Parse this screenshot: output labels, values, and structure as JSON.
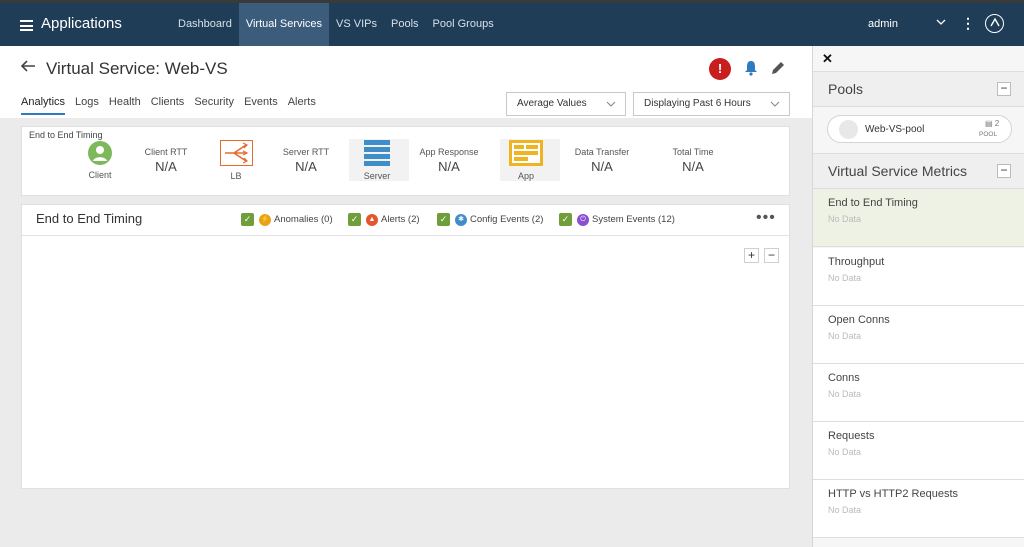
{
  "nav": {
    "title": "Applications",
    "tabs": [
      "Dashboard",
      "Virtual Services",
      "VS VIPs",
      "Pools",
      "Pool Groups"
    ],
    "user": "admin"
  },
  "header": {
    "title": "Virtual Service:  Web-VS",
    "alert_glyph": "!",
    "tabs": [
      "Analytics",
      "Logs",
      "Health",
      "Clients",
      "Security",
      "Events",
      "Alerts"
    ],
    "value_mode": "Average Values",
    "time_range": "Displaying Past 6 Hours"
  },
  "timing": {
    "label": "End to End Timing",
    "nodes": {
      "client": "Client",
      "lb": "LB",
      "server": "Server",
      "app": "App"
    },
    "metrics": [
      {
        "label": "Client RTT",
        "value": "N/A"
      },
      {
        "label": "Server RTT",
        "value": "N/A"
      },
      {
        "label": "App Response",
        "value": "N/A"
      },
      {
        "label": "Data Transfer",
        "value": "N/A"
      },
      {
        "label": "Total Time",
        "value": "N/A"
      }
    ]
  },
  "chart": {
    "title": "End to End Timing",
    "filters": [
      {
        "label": "Anomalies (0)",
        "color": "#e8a21a"
      },
      {
        "label": "Alerts (2)",
        "color": "#e2572f"
      },
      {
        "label": "Config Events (2)",
        "color": "#3f8ec9"
      },
      {
        "label": "System Events (12)",
        "color": "#8b4fd1"
      }
    ],
    "more": "•••",
    "zoom_in": "+",
    "zoom_out": "−"
  },
  "right_panel": {
    "pools_title": "Pools",
    "pool": {
      "name": "Web-VS-pool",
      "count": "2",
      "type": "POOL"
    },
    "metrics_title": "Virtual Service Metrics",
    "metrics": [
      {
        "title": "End to End Timing",
        "sub": "No Data"
      },
      {
        "title": "Throughput",
        "sub": "No Data"
      },
      {
        "title": "Open Conns",
        "sub": "No Data"
      },
      {
        "title": "Conns",
        "sub": "No Data"
      },
      {
        "title": "Requests",
        "sub": "No Data"
      },
      {
        "title": "HTTP vs HTTP2 Requests",
        "sub": "No Data"
      }
    ]
  }
}
